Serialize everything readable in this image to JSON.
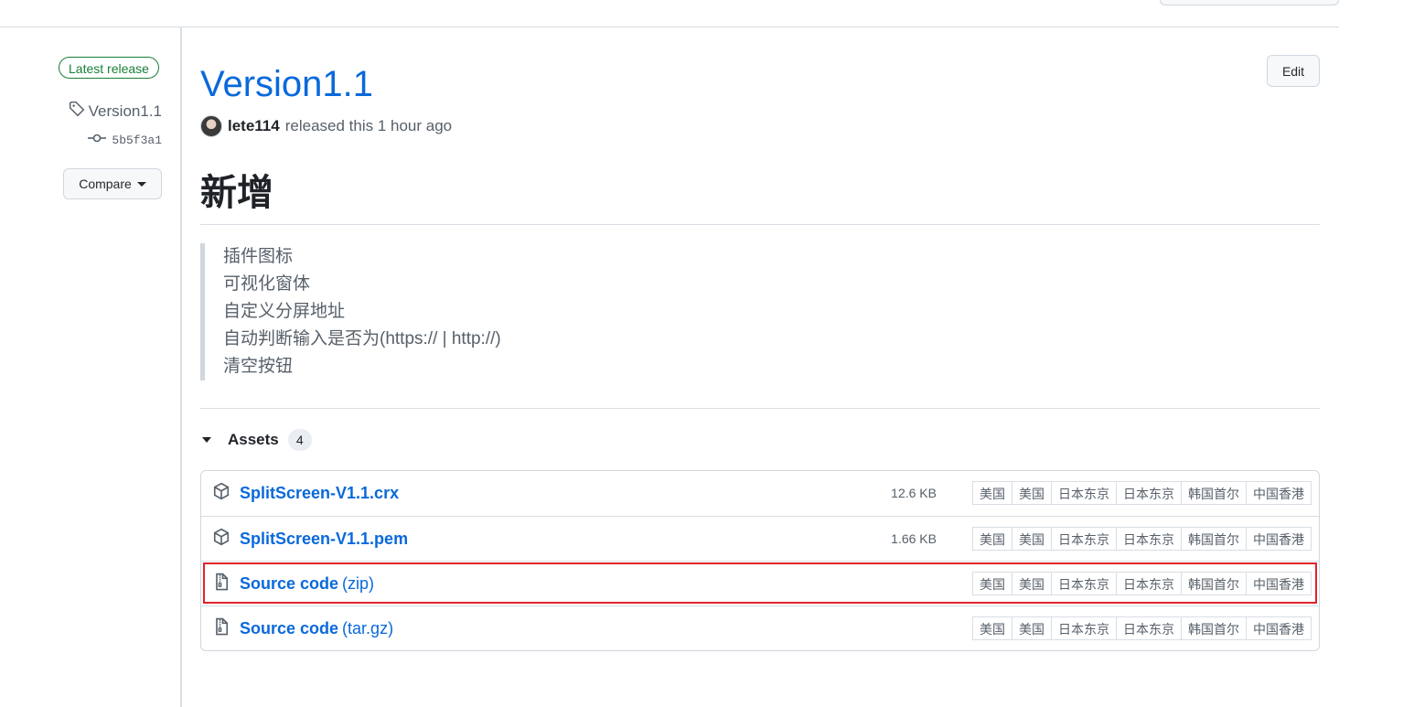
{
  "sidebar": {
    "badge": "Latest release",
    "tag": "Version1.1",
    "commit": "5b5f3a1",
    "compare_label": "Compare"
  },
  "release": {
    "title": "Version1.1",
    "edit_label": "Edit",
    "author": "lete114",
    "released_text": "released this 1 hour ago",
    "heading": "新增",
    "notes": [
      "插件图标",
      "可视化窗体",
      "自定义分屏地址",
      "自动判断输入是否为(https:// | http://)",
      "清空按钮"
    ]
  },
  "assets": {
    "label": "Assets",
    "count": "4",
    "items": [
      {
        "name": "SplitScreen-V1.1.crx",
        "suffix": "",
        "size": "12.6 KB",
        "icon": "package-icon"
      },
      {
        "name": "SplitScreen-V1.1.pem",
        "suffix": "",
        "size": "1.66 KB",
        "icon": "package-icon"
      },
      {
        "name": "Source code",
        "suffix": "(zip)",
        "size": "",
        "icon": "file-zip-icon"
      },
      {
        "name": "Source code",
        "suffix": "(tar.gz)",
        "size": "",
        "icon": "file-zip-icon"
      }
    ],
    "mirrors": [
      "美国",
      "美国",
      "日本东京",
      "日本东京",
      "韩国首尔",
      "中国香港"
    ]
  },
  "colors": {
    "link": "#0969da",
    "badge_green": "#1a7f37",
    "highlight_red": "#e0242b"
  }
}
